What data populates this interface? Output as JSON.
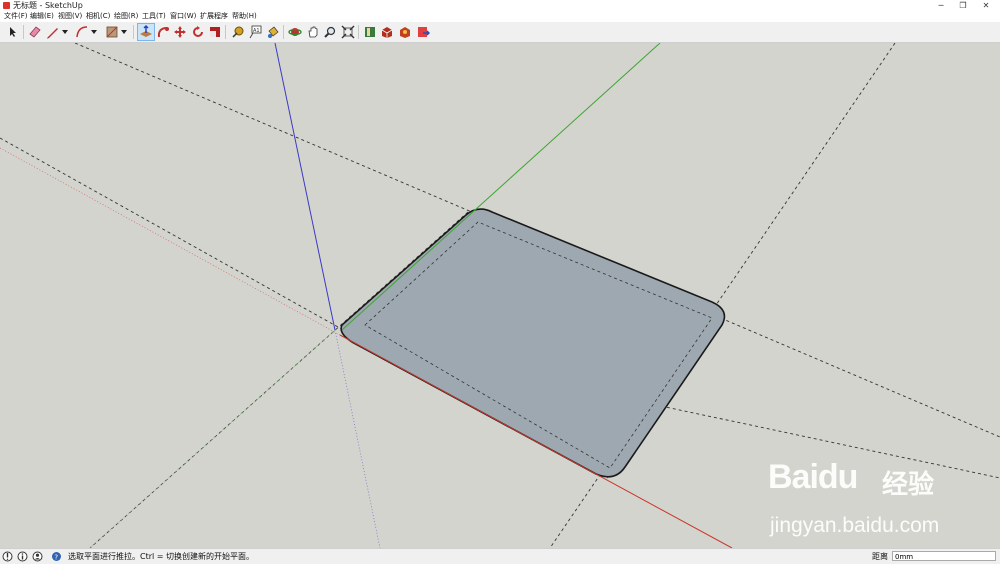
{
  "window": {
    "title": "无标题 - SketchUp",
    "minimize": "─",
    "restore": "❐",
    "close": "✕"
  },
  "menu": {
    "items": [
      "文件(F)",
      "编辑(E)",
      "视图(V)",
      "相机(C)",
      "绘图(R)",
      "工具(T)",
      "窗口(W)",
      "扩展程序",
      "帮助(H)"
    ]
  },
  "toolbar": {
    "tools": [
      "select",
      "eraser",
      "line",
      "line-dropdown",
      "arc",
      "arc-dropdown",
      "rectangle",
      "rectangle-dropdown",
      "push-pull",
      "follow-me",
      "move",
      "rotate",
      "scale",
      "tape-measure",
      "text",
      "paint-bucket",
      "orbit",
      "pan",
      "zoom",
      "zoom-extents",
      "previous-view",
      "warehouse",
      "extension-warehouse",
      "send-to-layout"
    ],
    "selected_tool": "push-pull"
  },
  "scene": {
    "axis_colors": {
      "red": "#c8352a",
      "green": "#3fa535",
      "blue": "#3a3ac8"
    },
    "face_color": "#9ea8b0",
    "background": "#d4d4ce"
  },
  "status": {
    "hint": "选取平面进行推拉。Ctrl = 切换创建新的开始平面。",
    "distance_label": "距离",
    "distance_value": "0mm"
  },
  "watermark": {
    "brand": "Baidu",
    "cn": "经验",
    "url": "jingyan.baidu.com"
  }
}
